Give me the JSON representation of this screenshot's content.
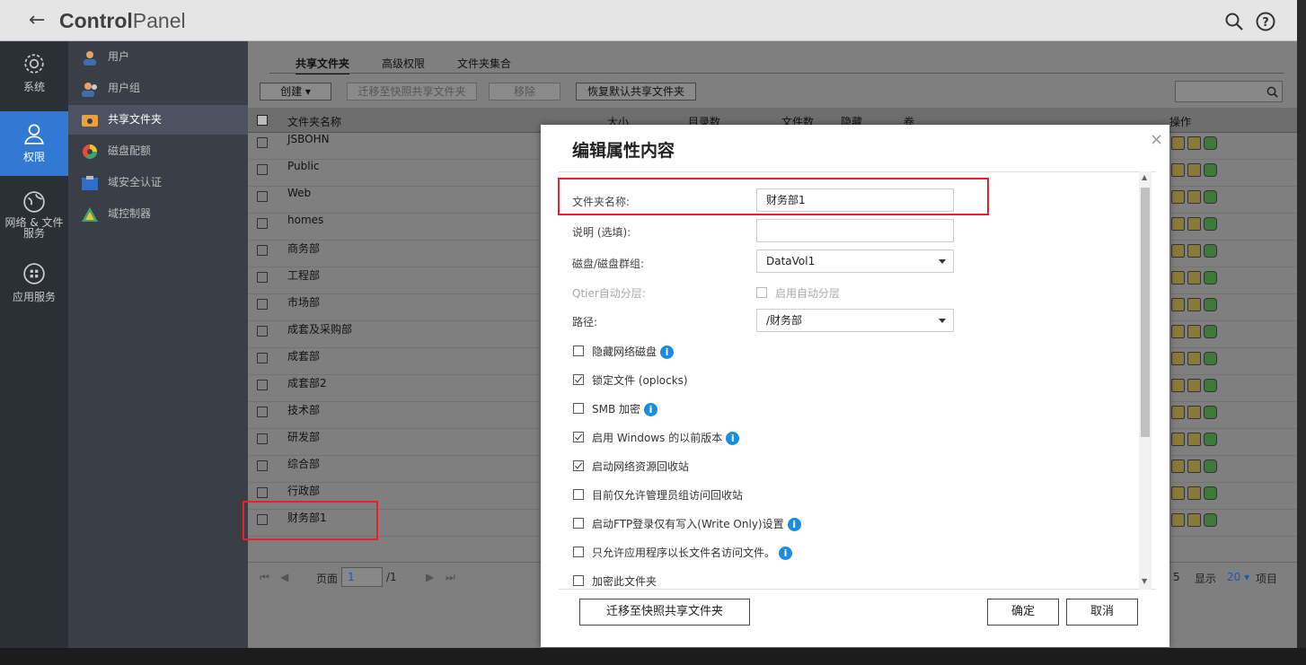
{
  "app": {
    "back_icon": "arrow-left-icon",
    "title_bold": "Control",
    "title_light": "Panel"
  },
  "left_nav": [
    {
      "label": "系统",
      "icon": "gear-icon"
    },
    {
      "label": "权限",
      "icon": "user-icon",
      "active": true
    },
    {
      "label": "网络 & 文件服务",
      "icon": "globe-icon"
    },
    {
      "label": "应用服务",
      "icon": "apps-grid-icon"
    }
  ],
  "sub_nav": [
    {
      "label": "用户"
    },
    {
      "label": "用户组"
    },
    {
      "label": "共享文件夹",
      "selected": true
    },
    {
      "label": "磁盘配额"
    },
    {
      "label": "域安全认证"
    },
    {
      "label": "域控制器"
    }
  ],
  "tabs": [
    "共享文件夹",
    "高级权限",
    "文件夹集合"
  ],
  "toolbar": {
    "create": "创建",
    "migrate": "迁移至快照共享文件夹",
    "remove": "移除",
    "restore": "恢复默认共享文件夹"
  },
  "table": {
    "headers": {
      "name": "文件夹名称",
      "size": "大小",
      "dirs": "目录数",
      "files": "文件数",
      "hidden": "隐藏",
      "volume": "卷",
      "actions": "操作"
    },
    "rows": [
      "JSBOHN",
      "Public",
      "Web",
      "homes",
      "商务部",
      "工程部",
      "市场部",
      "成套及采购部",
      "成套部",
      "成套部2",
      "技术部",
      "研发部",
      "综合部",
      "行政部",
      "财务部1"
    ]
  },
  "pager": {
    "page_label": "页面",
    "page_value": "1",
    "total": "/1",
    "show_label": "显示",
    "per_page": "20",
    "items_label": "项目",
    "edge_digit": "5"
  },
  "modal": {
    "title": "编辑属性内容",
    "fields": {
      "name_label": "文件夹名称:",
      "name_value": "财务部1",
      "desc_label": "说明 (选填):",
      "desc_value": "",
      "disk_label": "磁盘/磁盘群组:",
      "disk_value": "DataVol1",
      "qtier_label": "Qtier自动分层:",
      "qtier_opt": "启用自动分层",
      "path_label": "路径:",
      "path_value": "/财务部"
    },
    "options": [
      {
        "label": "隐藏网络磁盘",
        "checked": false,
        "info": true
      },
      {
        "label": "锁定文件 (oplocks)",
        "checked": true,
        "info": false
      },
      {
        "label": "SMB 加密",
        "checked": false,
        "info": true
      },
      {
        "label": "启用 Windows 的以前版本",
        "checked": true,
        "info": true
      },
      {
        "label": "启动网络资源回收站",
        "checked": true,
        "info": false
      },
      {
        "label": "目前仅允许管理员组访问回收站",
        "checked": false,
        "info": false
      },
      {
        "label": "启动FTP登录仅有写入(Write Only)设置",
        "checked": false,
        "info": true
      },
      {
        "label": "只允许应用程序以长文件名访问文件。",
        "checked": false,
        "info": true
      },
      {
        "label": "加密此文件夹",
        "checked": false,
        "info": false
      }
    ],
    "buttons": {
      "migrate": "迁移至快照共享文件夹",
      "ok": "确定",
      "cancel": "取消"
    }
  },
  "colors": {
    "accent": "#3279d4",
    "highlight": "#e8202a",
    "info": "#1a8de0"
  }
}
